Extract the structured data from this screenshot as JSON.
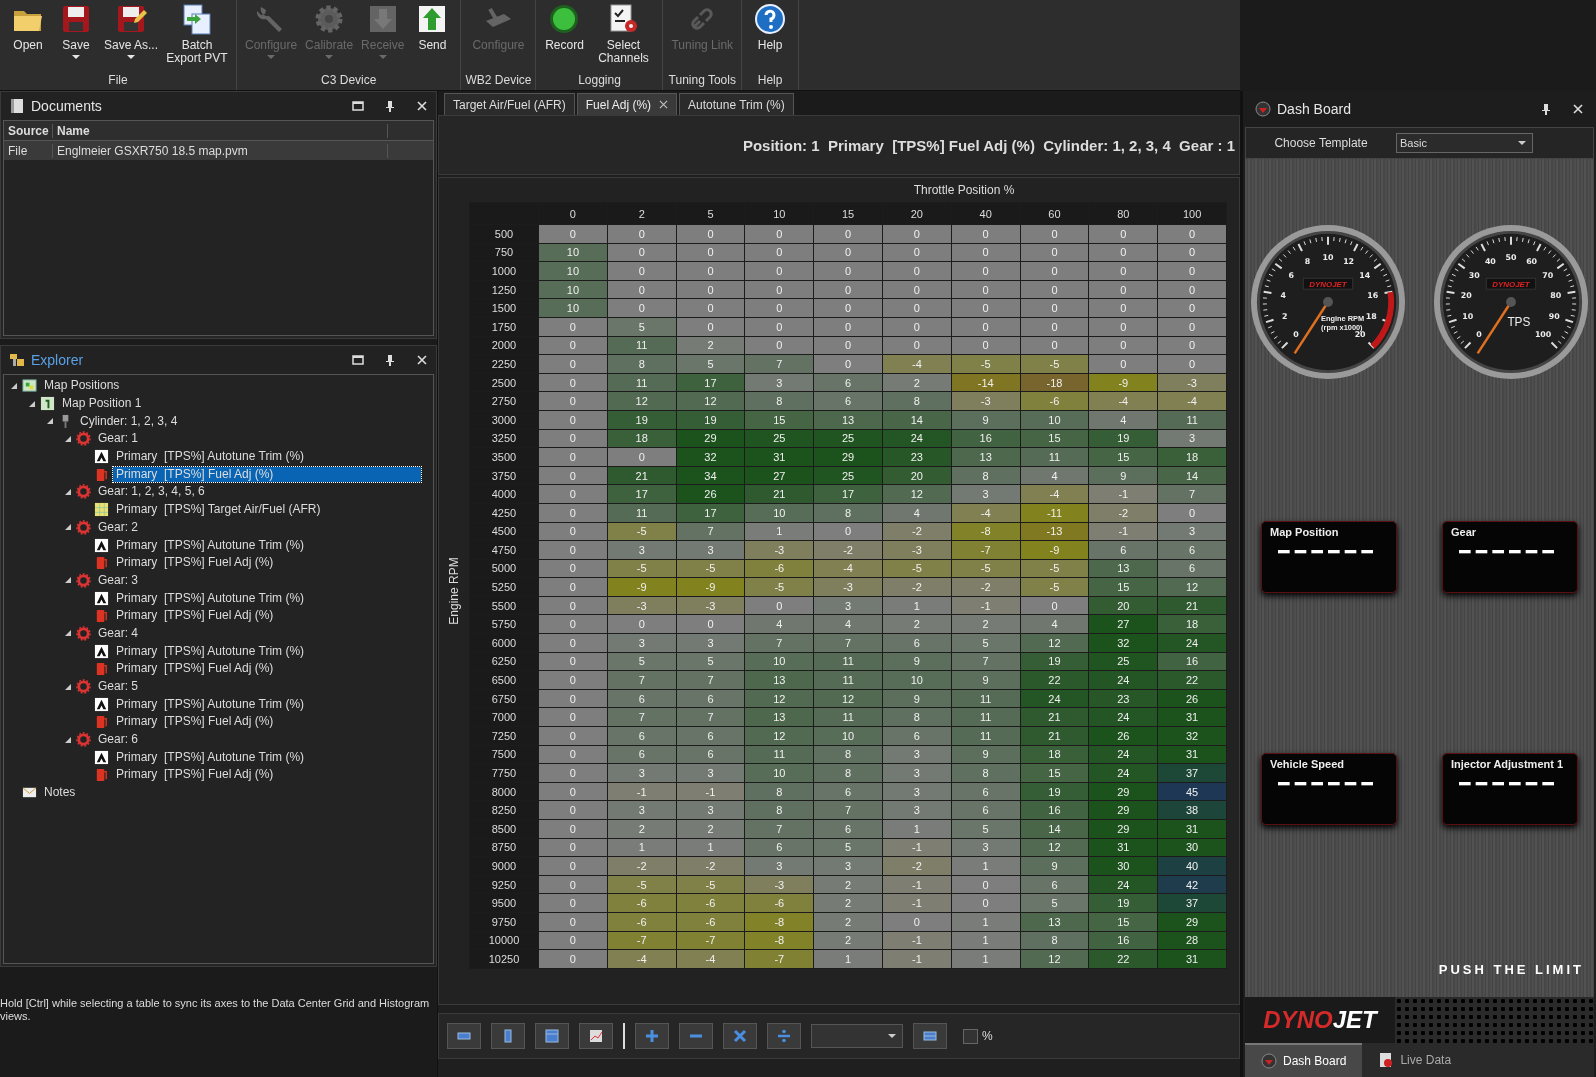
{
  "toolbar": {
    "groups": [
      {
        "label": "File",
        "buttons": [
          {
            "label": "Open",
            "kind": "folder",
            "disabled": false,
            "dropdown": false
          },
          {
            "label": "Save",
            "kind": "disk",
            "disabled": false,
            "dropdown": true
          },
          {
            "label": "Save As...",
            "kind": "disk-pen",
            "disabled": false,
            "dropdown": true
          },
          {
            "label": "Batch Export PVT",
            "kind": "batch",
            "disabled": false,
            "dropdown": false
          }
        ]
      },
      {
        "label": "C3 Device",
        "buttons": [
          {
            "label": "Configure",
            "kind": "wrench",
            "disabled": true,
            "dropdown": true
          },
          {
            "label": "Calibrate",
            "kind": "gear",
            "disabled": true,
            "dropdown": true
          },
          {
            "label": "Receive",
            "kind": "down-arrow",
            "disabled": true,
            "dropdown": true
          },
          {
            "label": "Send",
            "kind": "up-arrow",
            "disabled": false,
            "dropdown": false
          }
        ]
      },
      {
        "label": "WB2 Device",
        "buttons": [
          {
            "label": "Configure",
            "kind": "device",
            "disabled": true,
            "dropdown": false
          }
        ]
      },
      {
        "label": "Logging",
        "buttons": [
          {
            "label": "Record",
            "kind": "record",
            "disabled": false,
            "dropdown": false
          },
          {
            "label": "Select Channels",
            "kind": "checklist",
            "disabled": false,
            "dropdown": false
          }
        ]
      },
      {
        "label": "Tuning Tools",
        "buttons": [
          {
            "label": "Tuning Link",
            "kind": "link",
            "disabled": true,
            "dropdown": false
          }
        ]
      },
      {
        "label": "Help",
        "buttons": [
          {
            "label": "Help",
            "kind": "help",
            "disabled": false,
            "dropdown": false
          }
        ]
      }
    ]
  },
  "documents": {
    "title": "Documents",
    "columns": [
      "Source",
      "Name"
    ],
    "rows": [
      {
        "source": "File",
        "name": "Englmeier GSXR750 18.5 map.pvm"
      }
    ]
  },
  "explorer": {
    "title": "Explorer",
    "tree": [
      {
        "label": "Map Positions",
        "kind": "map-folder",
        "expanded": true,
        "selected": false,
        "children": [
          {
            "label": "Map Position 1",
            "kind": "map",
            "expanded": true,
            "selected": false,
            "children": [
              {
                "label": "Cylinder: 1, 2, 3, 4",
                "kind": "cylinder",
                "expanded": true,
                "selected": false,
                "children": [
                  {
                    "label": "Gear: 1",
                    "kind": "gear",
                    "expanded": true,
                    "selected": false,
                    "children": [
                      {
                        "label": "Primary  [TPS%] Autotune Trim (%)",
                        "kind": "autotune",
                        "selected": false
                      },
                      {
                        "label": "Primary  [TPS%] Fuel Adj (%)",
                        "kind": "fuel",
                        "selected": true
                      }
                    ]
                  },
                  {
                    "label": "Gear: 1, 2, 3, 4, 5, 6",
                    "kind": "gear",
                    "expanded": true,
                    "selected": false,
                    "children": [
                      {
                        "label": "Primary  [TPS%] Target Air/Fuel (AFR)",
                        "kind": "afr",
                        "selected": false
                      }
                    ]
                  },
                  {
                    "label": "Gear: 2",
                    "kind": "gear",
                    "expanded": true,
                    "selected": false,
                    "children": [
                      {
                        "label": "Primary  [TPS%] Autotune Trim (%)",
                        "kind": "autotune",
                        "selected": false
                      },
                      {
                        "label": "Primary  [TPS%] Fuel Adj (%)",
                        "kind": "fuel",
                        "selected": false
                      }
                    ]
                  },
                  {
                    "label": "Gear: 3",
                    "kind": "gear",
                    "expanded": true,
                    "selected": false,
                    "children": [
                      {
                        "label": "Primary  [TPS%] Autotune Trim (%)",
                        "kind": "autotune",
                        "selected": false
                      },
                      {
                        "label": "Primary  [TPS%] Fuel Adj (%)",
                        "kind": "fuel",
                        "selected": false
                      }
                    ]
                  },
                  {
                    "label": "Gear: 4",
                    "kind": "gear",
                    "expanded": true,
                    "selected": false,
                    "children": [
                      {
                        "label": "Primary  [TPS%] Autotune Trim (%)",
                        "kind": "autotune",
                        "selected": false
                      },
                      {
                        "label": "Primary  [TPS%] Fuel Adj (%)",
                        "kind": "fuel",
                        "selected": false
                      }
                    ]
                  },
                  {
                    "label": "Gear: 5",
                    "kind": "gear",
                    "expanded": true,
                    "selected": false,
                    "children": [
                      {
                        "label": "Primary  [TPS%] Autotune Trim (%)",
                        "kind": "autotune",
                        "selected": false
                      },
                      {
                        "label": "Primary  [TPS%] Fuel Adj (%)",
                        "kind": "fuel",
                        "selected": false
                      }
                    ]
                  },
                  {
                    "label": "Gear: 6",
                    "kind": "gear",
                    "expanded": true,
                    "selected": false,
                    "children": [
                      {
                        "label": "Primary  [TPS%] Autotune Trim (%)",
                        "kind": "autotune",
                        "selected": false
                      },
                      {
                        "label": "Primary  [TPS%] Fuel Adj (%)",
                        "kind": "fuel",
                        "selected": false
                      }
                    ]
                  }
                ]
              }
            ]
          }
        ]
      },
      {
        "label": "Notes",
        "kind": "notes",
        "selected": false
      }
    ]
  },
  "hint": "Hold [Ctrl] while selecting a table to sync its axes to the Data Center Grid and Histogram views.",
  "tabs": [
    {
      "label": "Target Air/Fuel (AFR)",
      "selected": false,
      "closable": false
    },
    {
      "label": "Fuel Adj (%)",
      "selected": true,
      "closable": true
    },
    {
      "label": "Autotune Trim (%)",
      "selected": false,
      "closable": false
    }
  ],
  "table_heading": "Position: 1  Primary  [TPS%] Fuel Adj (%)  Cylinder: 1, 2, 3, 4  Gear : 1",
  "grid": {
    "x_title": "Throttle Position %",
    "y_title": "Engine RPM",
    "columns": [
      "0",
      "2",
      "5",
      "10",
      "15",
      "20",
      "40",
      "60",
      "80",
      "100"
    ],
    "rows": [
      {
        "rpm": "500",
        "cells": [
          "0",
          "0",
          "0",
          "0",
          "0",
          "0",
          "0",
          "0",
          "0",
          "0"
        ]
      },
      {
        "rpm": "750",
        "cells": [
          "10",
          "0",
          "0",
          "0",
          "0",
          "0",
          "0",
          "0",
          "0",
          "0"
        ]
      },
      {
        "rpm": "1000",
        "cells": [
          "10",
          "0",
          "0",
          "0",
          "0",
          "0",
          "0",
          "0",
          "0",
          "0"
        ]
      },
      {
        "rpm": "1250",
        "cells": [
          "10",
          "0",
          "0",
          "0",
          "0",
          "0",
          "0",
          "0",
          "0",
          "0"
        ]
      },
      {
        "rpm": "1500",
        "cells": [
          "10",
          "0",
          "0",
          "0",
          "0",
          "0",
          "0",
          "0",
          "0",
          "0"
        ]
      },
      {
        "rpm": "1750",
        "cells": [
          "0",
          "5",
          "0",
          "0",
          "0",
          "0",
          "0",
          "0",
          "0",
          "0"
        ]
      },
      {
        "rpm": "2000",
        "cells": [
          "0",
          "11",
          "2",
          "0",
          "0",
          "0",
          "0",
          "0",
          "0",
          "0"
        ]
      },
      {
        "rpm": "2250",
        "cells": [
          "0",
          "8",
          "5",
          "7",
          "0",
          "-4",
          "-5",
          "-5",
          "0",
          "0"
        ]
      },
      {
        "rpm": "2500",
        "cells": [
          "0",
          "11",
          "17",
          "3",
          "6",
          "2",
          "-14",
          "-18",
          "-9",
          "-3"
        ]
      },
      {
        "rpm": "2750",
        "cells": [
          "0",
          "12",
          "12",
          "8",
          "6",
          "8",
          "-3",
          "-6",
          "-4",
          "-4"
        ]
      },
      {
        "rpm": "3000",
        "cells": [
          "0",
          "19",
          "19",
          "15",
          "13",
          "14",
          "9",
          "10",
          "4",
          "11"
        ]
      },
      {
        "rpm": "3250",
        "cells": [
          "0",
          "18",
          "29",
          "25",
          "25",
          "24",
          "16",
          "15",
          "19",
          "3"
        ]
      },
      {
        "rpm": "3500",
        "cells": [
          "0",
          "0",
          "32",
          "31",
          "29",
          "23",
          "13",
          "11",
          "15",
          "18"
        ]
      },
      {
        "rpm": "3750",
        "cells": [
          "0",
          "21",
          "34",
          "27",
          "25",
          "20",
          "8",
          "4",
          "9",
          "14"
        ]
      },
      {
        "rpm": "4000",
        "cells": [
          "0",
          "17",
          "26",
          "21",
          "17",
          "12",
          "3",
          "-4",
          "-1",
          "7"
        ]
      },
      {
        "rpm": "4250",
        "cells": [
          "0",
          "11",
          "17",
          "10",
          "8",
          "4",
          "-4",
          "-11",
          "-2",
          "0"
        ]
      },
      {
        "rpm": "4500",
        "cells": [
          "0",
          "-5",
          "7",
          "1",
          "0",
          "-2",
          "-8",
          "-13",
          "-1",
          "3"
        ]
      },
      {
        "rpm": "4750",
        "cells": [
          "0",
          "3",
          "3",
          "-3",
          "-2",
          "-3",
          "-7",
          "-9",
          "6",
          "6"
        ]
      },
      {
        "rpm": "5000",
        "cells": [
          "0",
          "-5",
          "-5",
          "-6",
          "-4",
          "-5",
          "-5",
          "-5",
          "13",
          "6"
        ]
      },
      {
        "rpm": "5250",
        "cells": [
          "0",
          "-9",
          "-9",
          "-5",
          "-3",
          "-2",
          "-2",
          "-5",
          "15",
          "12"
        ]
      },
      {
        "rpm": "5500",
        "cells": [
          "0",
          "-3",
          "-3",
          "0",
          "3",
          "1",
          "-1",
          "0",
          "20",
          "21"
        ]
      },
      {
        "rpm": "5750",
        "cells": [
          "0",
          "0",
          "0",
          "4",
          "4",
          "2",
          "2",
          "4",
          "27",
          "18"
        ]
      },
      {
        "rpm": "6000",
        "cells": [
          "0",
          "3",
          "3",
          "7",
          "7",
          "6",
          "5",
          "12",
          "32",
          "24"
        ]
      },
      {
        "rpm": "6250",
        "cells": [
          "0",
          "5",
          "5",
          "10",
          "11",
          "9",
          "7",
          "19",
          "25",
          "16"
        ]
      },
      {
        "rpm": "6500",
        "cells": [
          "0",
          "7",
          "7",
          "13",
          "11",
          "10",
          "9",
          "22",
          "24",
          "22"
        ]
      },
      {
        "rpm": "6750",
        "cells": [
          "0",
          "6",
          "6",
          "12",
          "12",
          "9",
          "11",
          "24",
          "23",
          "26"
        ]
      },
      {
        "rpm": "7000",
        "cells": [
          "0",
          "7",
          "7",
          "13",
          "11",
          "8",
          "11",
          "21",
          "24",
          "31"
        ]
      },
      {
        "rpm": "7250",
        "cells": [
          "0",
          "6",
          "6",
          "12",
          "10",
          "6",
          "11",
          "21",
          "26",
          "32"
        ]
      },
      {
        "rpm": "7500",
        "cells": [
          "0",
          "6",
          "6",
          "11",
          "8",
          "3",
          "9",
          "18",
          "24",
          "31"
        ]
      },
      {
        "rpm": "7750",
        "cells": [
          "0",
          "3",
          "3",
          "10",
          "8",
          "3",
          "8",
          "15",
          "24",
          "37"
        ]
      },
      {
        "rpm": "8000",
        "cells": [
          "0",
          "-1",
          "-1",
          "8",
          "6",
          "3",
          "6",
          "19",
          "29",
          "45"
        ]
      },
      {
        "rpm": "8250",
        "cells": [
          "0",
          "3",
          "3",
          "8",
          "7",
          "3",
          "6",
          "16",
          "29",
          "38"
        ]
      },
      {
        "rpm": "8500",
        "cells": [
          "0",
          "2",
          "2",
          "7",
          "6",
          "1",
          "5",
          "14",
          "29",
          "31"
        ]
      },
      {
        "rpm": "8750",
        "cells": [
          "0",
          "1",
          "1",
          "6",
          "5",
          "-1",
          "3",
          "12",
          "31",
          "30"
        ]
      },
      {
        "rpm": "9000",
        "cells": [
          "0",
          "-2",
          "-2",
          "3",
          "3",
          "-2",
          "1",
          "9",
          "30",
          "40"
        ]
      },
      {
        "rpm": "9250",
        "cells": [
          "0",
          "-5",
          "-5",
          "-3",
          "2",
          "-1",
          "0",
          "6",
          "24",
          "42"
        ]
      },
      {
        "rpm": "9500",
        "cells": [
          "0",
          "-6",
          "-6",
          "-6",
          "2",
          "-1",
          "0",
          "5",
          "19",
          "37"
        ]
      },
      {
        "rpm": "9750",
        "cells": [
          "0",
          "-6",
          "-6",
          "-8",
          "2",
          "0",
          "1",
          "13",
          "15",
          "29"
        ]
      },
      {
        "rpm": "10000",
        "cells": [
          "0",
          "-7",
          "-7",
          "-8",
          "2",
          "-1",
          "1",
          "8",
          "16",
          "28"
        ]
      },
      {
        "rpm": "10250",
        "cells": [
          "0",
          "-4",
          "-4",
          "-7",
          "1",
          "-1",
          "1",
          "12",
          "22",
          "31"
        ]
      }
    ]
  },
  "bottom_toolbar": {
    "tools": [
      {
        "kind": "row"
      },
      {
        "kind": "column"
      },
      {
        "kind": "table"
      },
      {
        "kind": "chart"
      },
      {
        "kind": "plus"
      },
      {
        "kind": "minus"
      },
      {
        "kind": "multiply"
      },
      {
        "kind": "divide"
      }
    ],
    "percent": {
      "label": "%",
      "checked": false
    }
  },
  "dashboard": {
    "title": "Dash Board",
    "template_label": "Choose Template",
    "template": "Basic",
    "gauges": [
      {
        "kind": "rpm",
        "labels": [
          "0",
          "2",
          "4",
          "6",
          "8",
          "10",
          "12",
          "14",
          "16",
          "18",
          "20"
        ],
        "caption": [
          "Engine RPM",
          "(rpm x1000)"
        ],
        "logo": "DYNOJET"
      },
      {
        "kind": "tps",
        "labels": [
          "0",
          "10",
          "20",
          "30",
          "40",
          "50",
          "60",
          "70",
          "80",
          "90",
          "100"
        ],
        "caption": [
          "TPS"
        ],
        "logo": "DYNOJET"
      }
    ],
    "displays": [
      {
        "label": "Map Position"
      },
      {
        "label": "Gear"
      },
      {
        "label": "Vehicle Speed"
      },
      {
        "label": "Injector Adjustment 1"
      }
    ],
    "slogan": "PUSH THE LIMIT",
    "logo": [
      "DYNO",
      "JET"
    ],
    "tabs": [
      {
        "label": "Dash Board",
        "selected": true
      },
      {
        "label": "Live Data",
        "selected": false
      }
    ]
  }
}
